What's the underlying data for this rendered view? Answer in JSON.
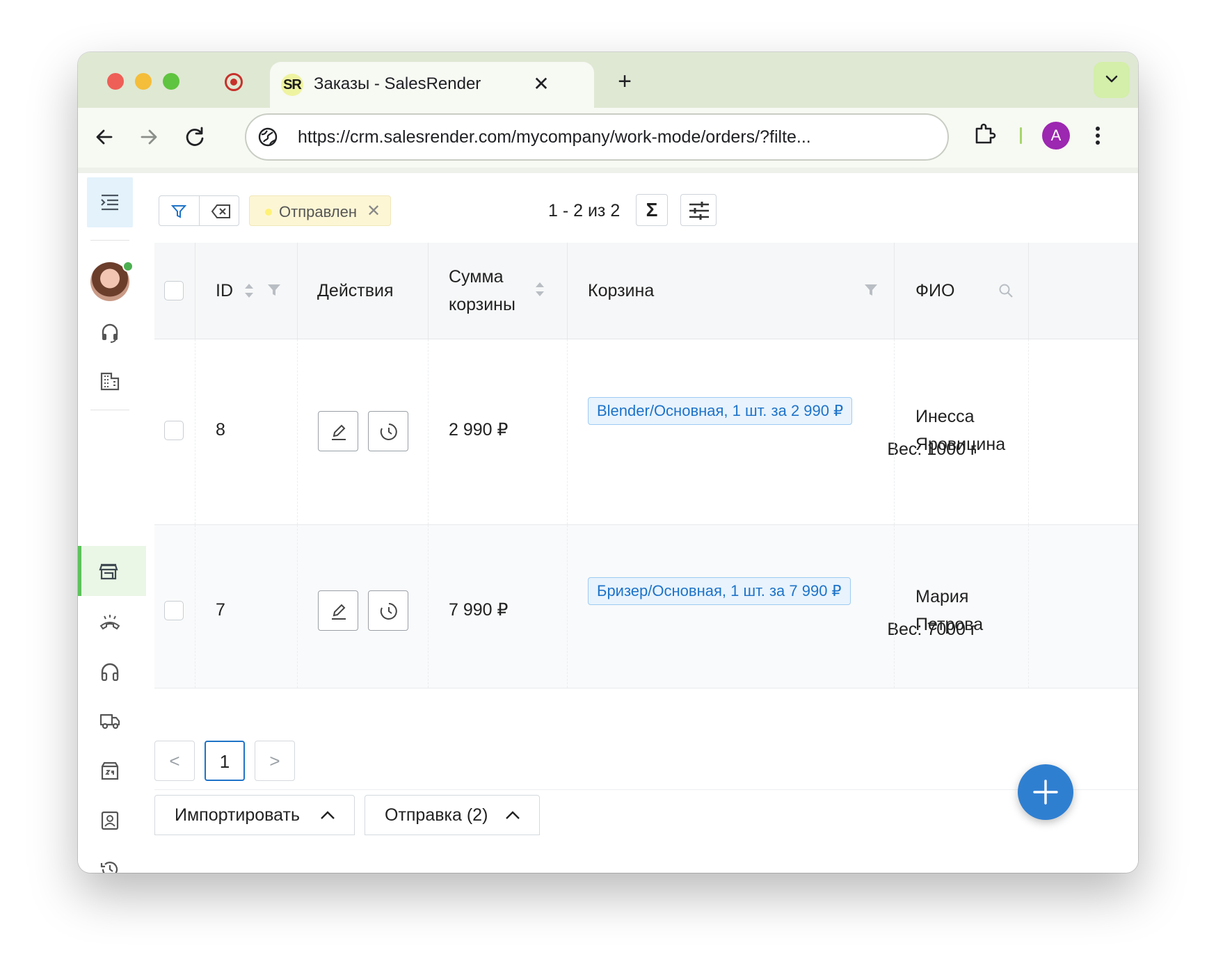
{
  "browser": {
    "tab": {
      "favicon_text": "SR",
      "title": "Заказы - SalesRender",
      "close": "✕"
    },
    "new_tab": "+",
    "url": "https://crm.salesrender.com/mycompany/work-mode/orders/?filte...",
    "profile_initial": "A"
  },
  "toolbar": {
    "filter_chip": "Отправлен",
    "chip_close": "✕",
    "count": "1 - 2 из 2",
    "sigma": "Σ"
  },
  "table": {
    "columns": [
      {
        "label": "ID"
      },
      {
        "label": "Действия"
      },
      {
        "label_line1": "Сумма",
        "label_line2": "корзины"
      },
      {
        "label": "Корзина"
      },
      {
        "label": "ФИО"
      }
    ],
    "rows": [
      {
        "id": "8",
        "sum": "2 990 ₽",
        "cart_item": "Blender/Основная, 1 шт. за 2 990 ₽",
        "weight": "Вес: 1000 г",
        "name_line1": "Инесса",
        "name_line2": "Яровицина"
      },
      {
        "id": "7",
        "sum": "7 990 ₽",
        "cart_item": "Бризер/Основная, 1 шт. за 7 990 ₽",
        "weight": "Вес: 7000 г",
        "name_line1": "Мария",
        "name_line2": "Петрова"
      }
    ]
  },
  "pagination": {
    "prev": "<",
    "current": "1",
    "next": ">"
  },
  "bottom": {
    "import_label": "Импортировать",
    "send_label": "Отправка (2)"
  },
  "colors": {
    "accent_blue": "#2f7fd1",
    "active_green": "#5cc35a",
    "chip_yellow": "#fdf6d5"
  }
}
